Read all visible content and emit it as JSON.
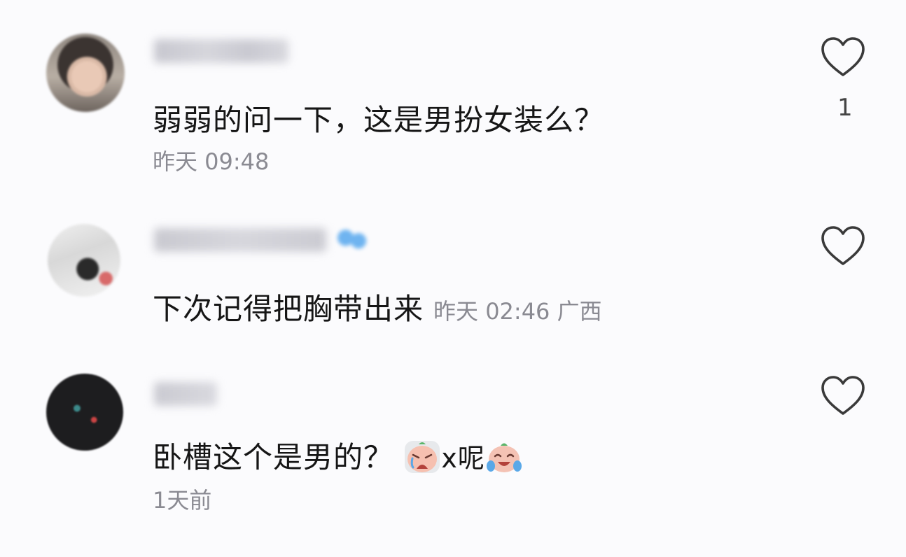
{
  "comments": [
    {
      "text": "弱弱的问一下，这是男扮女装么？",
      "meta": "昨天 09:48",
      "like_count": "1",
      "like_icon": "heart-outline-icon"
    },
    {
      "text": "下次记得把胸带出来",
      "meta": "昨天 02:46 广西",
      "like_icon": "heart-outline-icon"
    },
    {
      "text_before": "卧槽这个是男的？",
      "text_mid": "x呢",
      "emoji_1": "crying-face-emoji",
      "emoji_2": "tears-of-joy-emoji",
      "meta": "1天前",
      "like_icon": "heart-outline-icon"
    }
  ],
  "colors": {
    "background": "#fbfbfd",
    "text": "#161616",
    "meta": "#8a8a92",
    "heart_stroke": "#3a3a3a",
    "badge": "#6fb4f0"
  }
}
